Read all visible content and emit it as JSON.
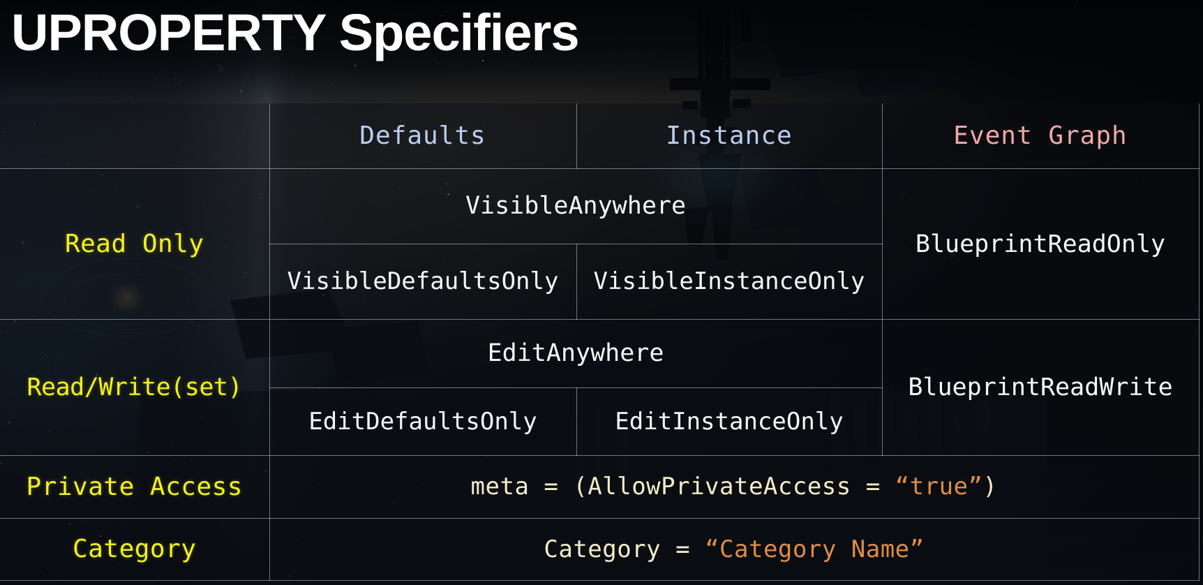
{
  "title": "UPROPERTY Specifiers",
  "table": {
    "columns": [
      {
        "key": "label",
        "header": ""
      },
      {
        "key": "defaults",
        "header": "Defaults",
        "color": "#b9cdf0"
      },
      {
        "key": "instance",
        "header": "Instance",
        "color": "#b9cdf0"
      },
      {
        "key": "graph",
        "header": "Event Graph",
        "color": "#f0a8a8"
      }
    ],
    "rows": {
      "read_only": {
        "label": "Read Only",
        "anywhere": "VisibleAnywhere",
        "defaults_only": "VisibleDefaultsOnly",
        "instance_only": "VisibleInstanceOnly",
        "blueprint": "BlueprintReadOnly"
      },
      "read_write": {
        "label": "Read/Write(set)",
        "anywhere": "EditAnywhere",
        "defaults_only": "EditDefaultsOnly",
        "instance_only": "EditInstanceOnly",
        "blueprint": "BlueprintReadWrite"
      },
      "private_access": {
        "label": "Private Access",
        "code_prefix": "meta = (AllowPrivateAccess = ",
        "code_string": "“true”",
        "code_suffix": ")"
      },
      "category": {
        "label": "Category",
        "code_prefix": "Category = ",
        "code_string": "“Category Name”",
        "code_suffix": ""
      }
    }
  },
  "colors": {
    "label_yellow": "#f2f024",
    "header_blue": "#b9cdf0",
    "header_pink": "#f0a8a8",
    "spec_white": "#f6f7f9",
    "code_cream": "#f4ecc8",
    "code_orange": "#e08c46",
    "grid_line": "#d0d8e4",
    "title_white": "#ffffff"
  }
}
